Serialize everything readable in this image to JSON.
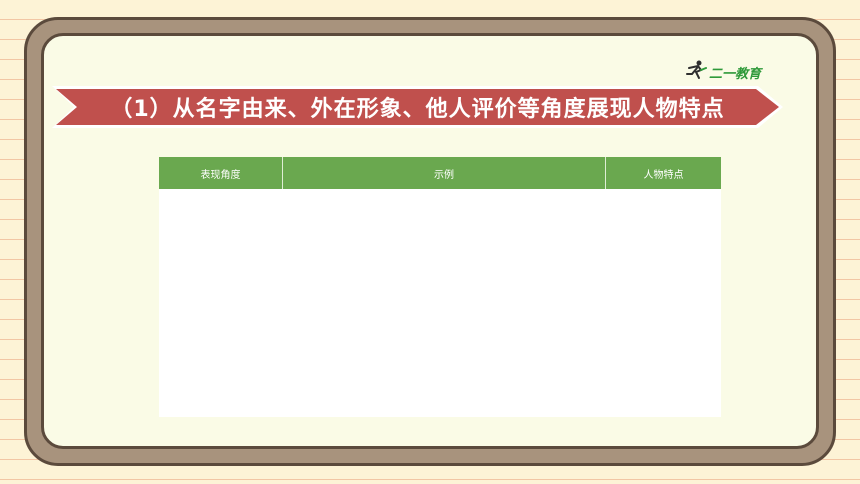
{
  "slide": {
    "banner_title": "（1）从名字由来、外在形象、他人评价等角度展现人物特点",
    "logo_text": "二一教育"
  },
  "table": {
    "headers": [
      "表现角度",
      "示例",
      "人物特点"
    ],
    "rows": []
  },
  "colors": {
    "banner": "#c0504d",
    "table_header": "#6aa84f",
    "frame": "#a8937d",
    "panel": "#fafbe6",
    "page_background": "#fdf3d6"
  }
}
